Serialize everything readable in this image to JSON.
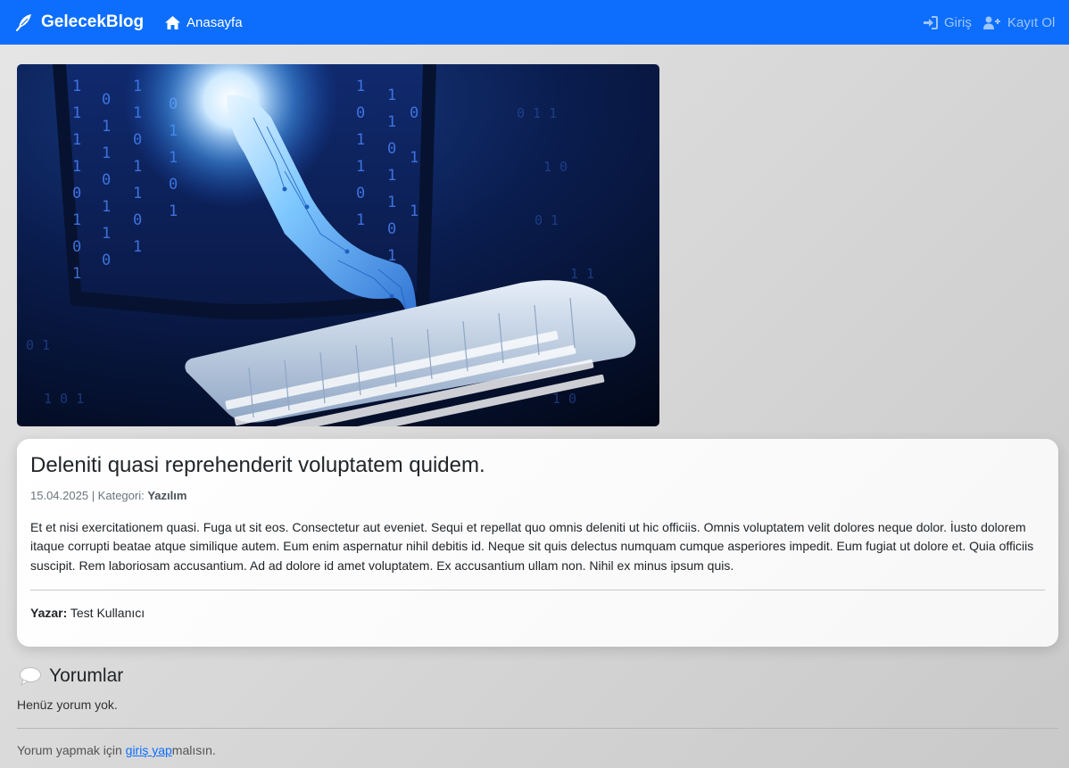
{
  "navbar": {
    "brand": "GelecekBlog",
    "brand_icon": "feather-pen-icon",
    "home_label": "Anasayfa",
    "home_icon": "home-icon",
    "login_label": "Giriş",
    "login_icon": "sign-in-icon",
    "register_label": "Kayıt Ol",
    "register_icon": "user-plus-icon",
    "bg_color": "#0d6efd"
  },
  "post": {
    "image_alt": "Dijital el klavyeye dokunuyor",
    "title": "Deleniti quasi reprehenderit voluptatem quidem.",
    "date": "15.04.2025",
    "separator": " | Kategori: ",
    "category": "Yazılım",
    "body": "Et et nisi exercitationem quasi. Fuga ut sit eos. Consectetur aut eveniet. Sequi et repellat quo omnis deleniti ut hic officiis. Omnis voluptatem velit dolores neque dolor. İusto dolorem itaque corrupti beatae atque similique autem. Eum enim aspernatur nihil debitis id. Neque sit quis delectus numquam cumque asperiores impedit. Eum fugiat ut dolore et. Quia officiis suscipit. Rem laboriosam accusantium. Ad ad dolore id amet voluptatem. Ex accusantium ullam non. Nihil ex minus ipsum quis.",
    "author_label": "Yazar:",
    "author_name": " Test Kullanıcı"
  },
  "comments": {
    "icon": "speech-bubble-icon",
    "title": "Yorumlar",
    "empty_text": "Henüz yorum yok.",
    "login_prefix": "Yorum yapmak için ",
    "login_link": "giriş yap",
    "login_suffix": "malısın.",
    "link_color": "#0d6efd"
  }
}
